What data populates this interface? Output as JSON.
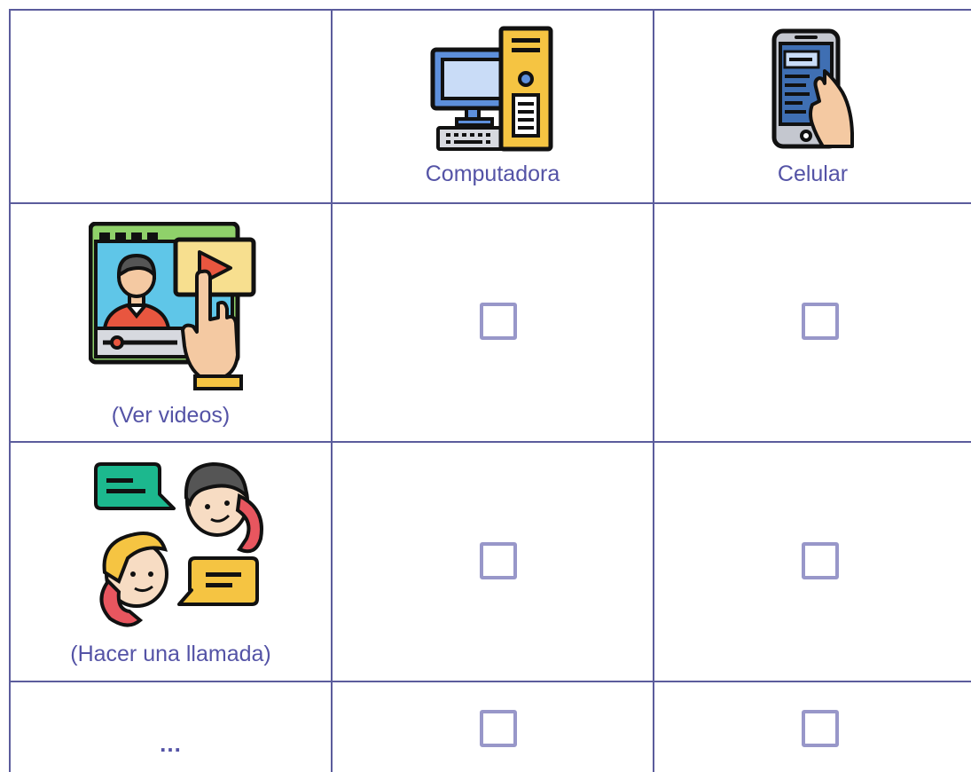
{
  "header": {
    "columns": [
      {
        "label": "Computadora",
        "icon": "desktop-computer-icon"
      },
      {
        "label": "Celular",
        "icon": "smartphone-icon"
      }
    ]
  },
  "rows": [
    {
      "label": "(Ver videos)",
      "icon": "video-streaming-icon",
      "checks": [
        false,
        false
      ]
    },
    {
      "label": "(Hacer una llamada)",
      "icon": "phone-call-icon",
      "checks": [
        false,
        false
      ]
    },
    {
      "label": "...",
      "checks": [
        false,
        false
      ]
    }
  ],
  "colors": {
    "grid_line": "#5b5c9c",
    "text": "#5453a6",
    "checkbox": "#9897c9"
  }
}
